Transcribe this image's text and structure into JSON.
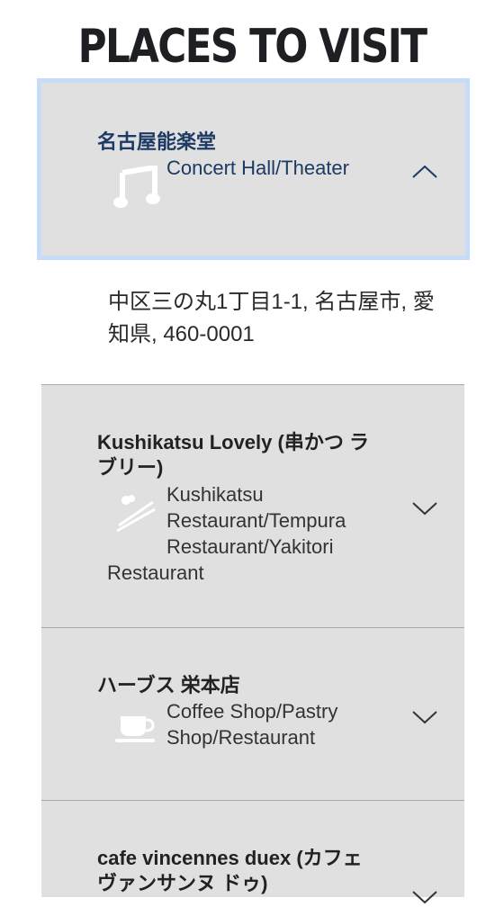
{
  "header": {
    "title": "PLACES TO VISIT"
  },
  "places": [
    {
      "title": "名古屋能楽堂",
      "category": "Concert Hall/Theater",
      "icon": "music-note-icon",
      "expanded": true,
      "address": "中区三の丸1丁目1-1, 名古屋市, 愛知県, 460-0001"
    },
    {
      "title_line1": "Kushikatsu Lovely (串かつ ラ",
      "title_line2": "ブリー)",
      "category_line1": "Kushikatsu",
      "category_line2": "Restaurant/Tempura",
      "category_line3": "Restaurant/Yakitori",
      "category_line4": "Restaurant",
      "icon": "skewer-food-icon",
      "expanded": false
    },
    {
      "title": "ハーブス 栄本店",
      "category_line1": "Coffee Shop/Pastry",
      "category_line2": "Shop/Restaurant",
      "icon": "coffee-cup-icon",
      "expanded": false
    },
    {
      "title_line1": "cafe vincennes duex (カフェ",
      "title_line2": "ヴァンサンヌ ドゥ)",
      "icon": "chevron-down-icon",
      "expanded": false
    }
  ]
}
